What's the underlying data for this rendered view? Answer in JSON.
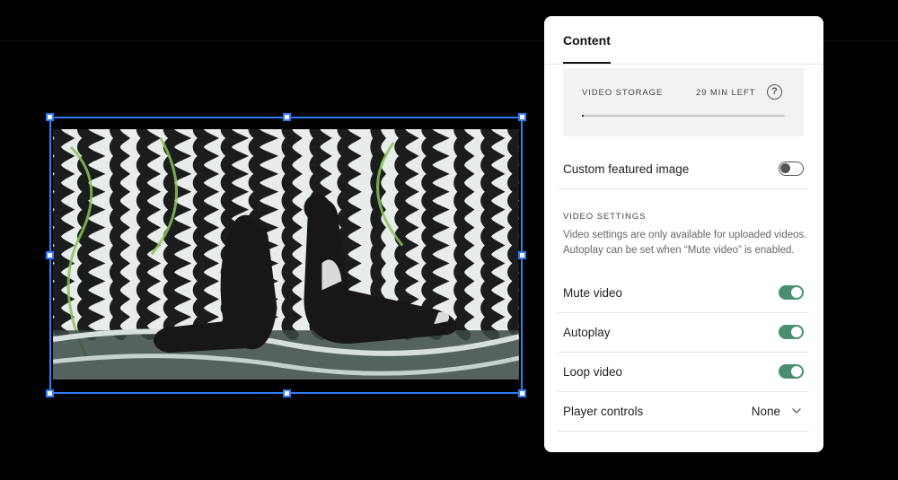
{
  "panel": {
    "tabs": [
      {
        "label": "Content"
      }
    ],
    "storage": {
      "label": "VIDEO STORAGE",
      "remaining": "29 MIN LEFT",
      "help_icon": "?",
      "used_fraction": 0.01
    },
    "custom_image": {
      "label": "Custom featured image",
      "enabled": false
    },
    "video_settings": {
      "title": "VIDEO SETTINGS",
      "description": "Video settings are only available for uploaded videos. Autoplay can be set when “Mute video” is enabled.",
      "mute": {
        "label": "Mute video",
        "enabled": true
      },
      "autoplay": {
        "label": "Autoplay",
        "enabled": true
      },
      "loop": {
        "label": "Loop video",
        "enabled": true
      },
      "player_controls": {
        "label": "Player controls",
        "value": "None"
      }
    }
  },
  "colors": {
    "selection": "#2f7cf6",
    "toggle_on": "#4a8f73",
    "background": "#000000"
  },
  "icons": [
    "help-icon",
    "chevron-down-icon"
  ]
}
